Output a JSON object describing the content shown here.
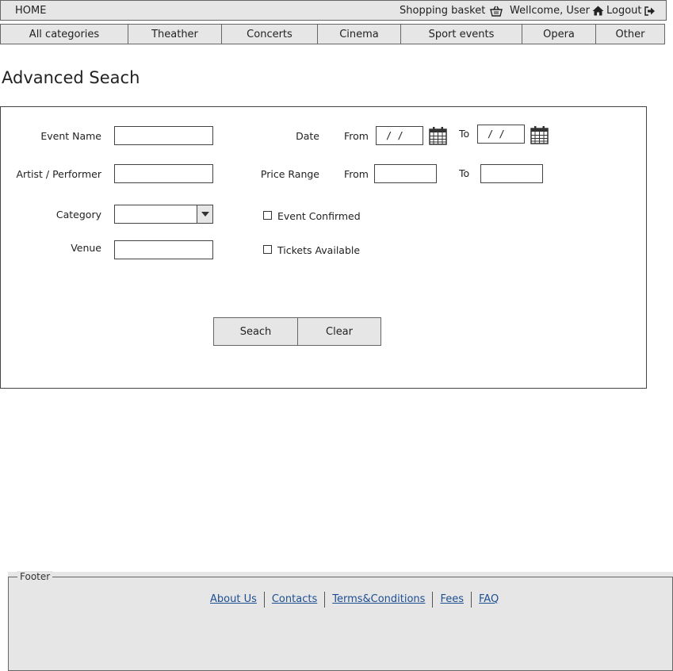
{
  "topbar": {
    "home": "HOME",
    "basket": "Shopping basket",
    "welcome": "Wellcome, User",
    "logout": "Logout"
  },
  "categories": [
    "All categories",
    "Theather",
    "Concerts",
    "Cinema",
    "Sport events",
    "Opera",
    "Other"
  ],
  "page": {
    "title": "Advanced Seach"
  },
  "form": {
    "event_name_label": "Event Name",
    "artist_label": "Artist / Performer",
    "category_label": "Category",
    "venue_label": "Venue",
    "date_label": "Date",
    "date_from_label": "From",
    "date_to_label": "To",
    "date_from_value": "/ /",
    "date_to_value": "/ /",
    "price_label": "Price Range",
    "price_from_label": "From",
    "price_to_label": "To",
    "event_confirmed_label": "Event Confirmed",
    "tickets_available_label": "Tickets Available",
    "search_button": "Seach",
    "clear_button": "Clear"
  },
  "footer": {
    "legend": "Footer",
    "links": [
      "About Us",
      "Contacts",
      "Terms&Conditions",
      "Fees",
      "FAQ"
    ]
  },
  "icons": {
    "basket": "basket-icon",
    "user": "home-icon",
    "logout": "logout-icon",
    "calendar": "calendar-icon",
    "dropdown": "chevron-down-icon"
  }
}
